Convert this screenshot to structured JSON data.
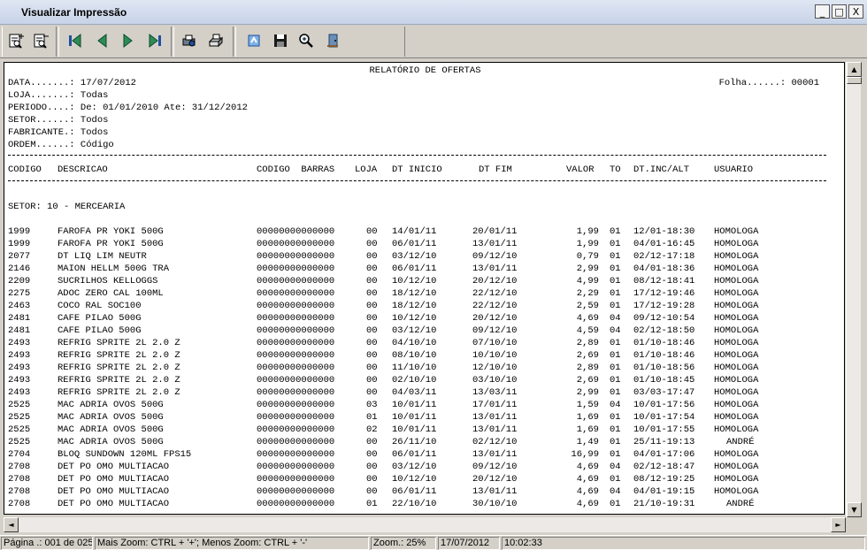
{
  "window": {
    "title": "Visualizar Impressão",
    "controls": {
      "minimize": "_",
      "maximize": "□",
      "close": "X"
    }
  },
  "toolbar": {
    "buttons": [
      {
        "name": "zoom-in-page-button",
        "icon": "page-plus-icon"
      },
      {
        "name": "zoom-out-page-button",
        "icon": "page-minus-icon"
      },
      {
        "name": "first-page-button",
        "icon": "first-arrow-icon"
      },
      {
        "name": "previous-page-button",
        "icon": "left-arrow-icon"
      },
      {
        "name": "next-page-button",
        "icon": "right-arrow-icon"
      },
      {
        "name": "last-page-button",
        "icon": "last-arrow-icon"
      },
      {
        "name": "printer-setup-button",
        "icon": "printer-setup-icon"
      },
      {
        "name": "print-button",
        "icon": "printer-icon"
      },
      {
        "name": "export-button",
        "icon": "export-icon"
      },
      {
        "name": "save-button",
        "icon": "floppy-icon"
      },
      {
        "name": "zoom-button",
        "icon": "magnifier-icon"
      },
      {
        "name": "exit-button",
        "icon": "exit-door-icon"
      }
    ],
    "colors": {
      "arrow": "#2e8b57",
      "accent": "#1f4fa0"
    }
  },
  "report": {
    "title": "RELATÓRIO DE OFERTAS",
    "header_lines": [
      "DATA.......: 17/07/2012",
      "LOJA.......: Todas",
      "PERIODO....: De: 01/01/2010 Ate: 31/12/2012",
      "SETOR......: Todos",
      "FABRICANTE.: Todos",
      "ORDEM......: Código"
    ],
    "folha": "Folha......: 00001",
    "columns": [
      "CODIGO",
      "DESCRICAO",
      "CODIGO  BARRAS",
      "LOJA",
      "DT INICIO",
      "DT FIM",
      "VALOR",
      "TO",
      "DT.INC/ALT",
      "USUARIO"
    ],
    "setor_label": "SETOR: 10 - MERCEARIA",
    "rows": [
      [
        "1999",
        "FAROFA PR YOKI 500G",
        "00000000000000",
        "00",
        "14/01/11",
        "20/01/11",
        "1,99",
        "01",
        "12/01-18:30",
        "HOMOLOGA"
      ],
      [
        "1999",
        "FAROFA PR YOKI 500G",
        "00000000000000",
        "00",
        "06/01/11",
        "13/01/11",
        "1,99",
        "01",
        "04/01-16:45",
        "HOMOLOGA"
      ],
      [
        "2077",
        "DT LIQ LIM NEUTR",
        "00000000000000",
        "00",
        "03/12/10",
        "09/12/10",
        "0,79",
        "01",
        "02/12-17:18",
        "HOMOLOGA"
      ],
      [
        "2146",
        "MAION HELLM 500G TRA",
        "00000000000000",
        "00",
        "06/01/11",
        "13/01/11",
        "2,99",
        "01",
        "04/01-18:36",
        "HOMOLOGA"
      ],
      [
        "2209",
        "SUCRILHOS KELLOGGS",
        "00000000000000",
        "00",
        "10/12/10",
        "20/12/10",
        "4,99",
        "01",
        "08/12-18:41",
        "HOMOLOGA"
      ],
      [
        "2275",
        "ADOC ZERO CAL 100ML",
        "00000000000000",
        "00",
        "18/12/10",
        "22/12/10",
        "2,29",
        "01",
        "17/12-19:46",
        "HOMOLOGA"
      ],
      [
        "2463",
        "COCO RAL SOC100",
        "00000000000000",
        "00",
        "18/12/10",
        "22/12/10",
        "2,59",
        "01",
        "17/12-19:28",
        "HOMOLOGA"
      ],
      [
        "2481",
        "CAFE PILAO 500G",
        "00000000000000",
        "00",
        "10/12/10",
        "20/12/10",
        "4,69",
        "04",
        "09/12-10:54",
        "HOMOLOGA"
      ],
      [
        "2481",
        "CAFE PILAO 500G",
        "00000000000000",
        "00",
        "03/12/10",
        "09/12/10",
        "4,59",
        "04",
        "02/12-18:50",
        "HOMOLOGA"
      ],
      [
        "2493",
        "REFRIG SPRITE 2L 2.0 Z",
        "00000000000000",
        "00",
        "04/10/10",
        "07/10/10",
        "2,89",
        "01",
        "01/10-18:46",
        "HOMOLOGA"
      ],
      [
        "2493",
        "REFRIG SPRITE 2L 2.0 Z",
        "00000000000000",
        "00",
        "08/10/10",
        "10/10/10",
        "2,69",
        "01",
        "01/10-18:46",
        "HOMOLOGA"
      ],
      [
        "2493",
        "REFRIG SPRITE 2L 2.0 Z",
        "00000000000000",
        "00",
        "11/10/10",
        "12/10/10",
        "2,89",
        "01",
        "01/10-18:56",
        "HOMOLOGA"
      ],
      [
        "2493",
        "REFRIG SPRITE 2L 2.0 Z",
        "00000000000000",
        "00",
        "02/10/10",
        "03/10/10",
        "2,69",
        "01",
        "01/10-18:45",
        "HOMOLOGA"
      ],
      [
        "2493",
        "REFRIG SPRITE 2L 2.0 Z",
        "00000000000000",
        "00",
        "04/03/11",
        "13/03/11",
        "2,99",
        "01",
        "03/03-17:47",
        "HOMOLOGA"
      ],
      [
        "2525",
        "MAC ADRIA OVOS 500G",
        "00000000000000",
        "03",
        "10/01/11",
        "17/01/11",
        "1,59",
        "04",
        "10/01-17:56",
        "HOMOLOGA"
      ],
      [
        "2525",
        "MAC ADRIA OVOS 500G",
        "00000000000000",
        "01",
        "10/01/11",
        "13/01/11",
        "1,69",
        "01",
        "10/01-17:54",
        "HOMOLOGA"
      ],
      [
        "2525",
        "MAC ADRIA OVOS 500G",
        "00000000000000",
        "02",
        "10/01/11",
        "13/01/11",
        "1,69",
        "01",
        "10/01-17:55",
        "HOMOLOGA"
      ],
      [
        "2525",
        "MAC ADRIA OVOS 500G",
        "00000000000000",
        "00",
        "26/11/10",
        "02/12/10",
        "1,49",
        "01",
        "25/11-19:13",
        "ANDRÉ"
      ],
      [
        "2704",
        "BLOQ SUNDOWN 120ML FPS15",
        "00000000000000",
        "00",
        "06/01/11",
        "13/01/11",
        "16,99",
        "01",
        "04/01-17:06",
        "HOMOLOGA"
      ],
      [
        "2708",
        "DET PO OMO MULTIACAO",
        "00000000000000",
        "00",
        "03/12/10",
        "09/12/10",
        "4,69",
        "04",
        "02/12-18:47",
        "HOMOLOGA"
      ],
      [
        "2708",
        "DET PO OMO MULTIACAO",
        "00000000000000",
        "00",
        "10/12/10",
        "20/12/10",
        "4,69",
        "01",
        "08/12-19:25",
        "HOMOLOGA"
      ],
      [
        "2708",
        "DET PO OMO MULTIACAO",
        "00000000000000",
        "00",
        "06/01/11",
        "13/01/11",
        "4,69",
        "04",
        "04/01-19:15",
        "HOMOLOGA"
      ],
      [
        "2708",
        "DET PO OMO MULTIACAO",
        "00000000000000",
        "01",
        "22/10/10",
        "30/10/10",
        "4,69",
        "01",
        "21/10-19:31",
        "ANDRÉ"
      ]
    ]
  },
  "scrollbar": {
    "up": "▲",
    "down": "▼",
    "left": "◄",
    "right": "►"
  },
  "statusbar": {
    "page": "Página .: 001 de 025",
    "zoom_hint": "Mais Zoom: CTRL + '+'; Menos Zoom: CTRL + '-'",
    "zoom": "Zoom.: 25%",
    "date": "17/07/2012",
    "time": "10:02:33"
  }
}
